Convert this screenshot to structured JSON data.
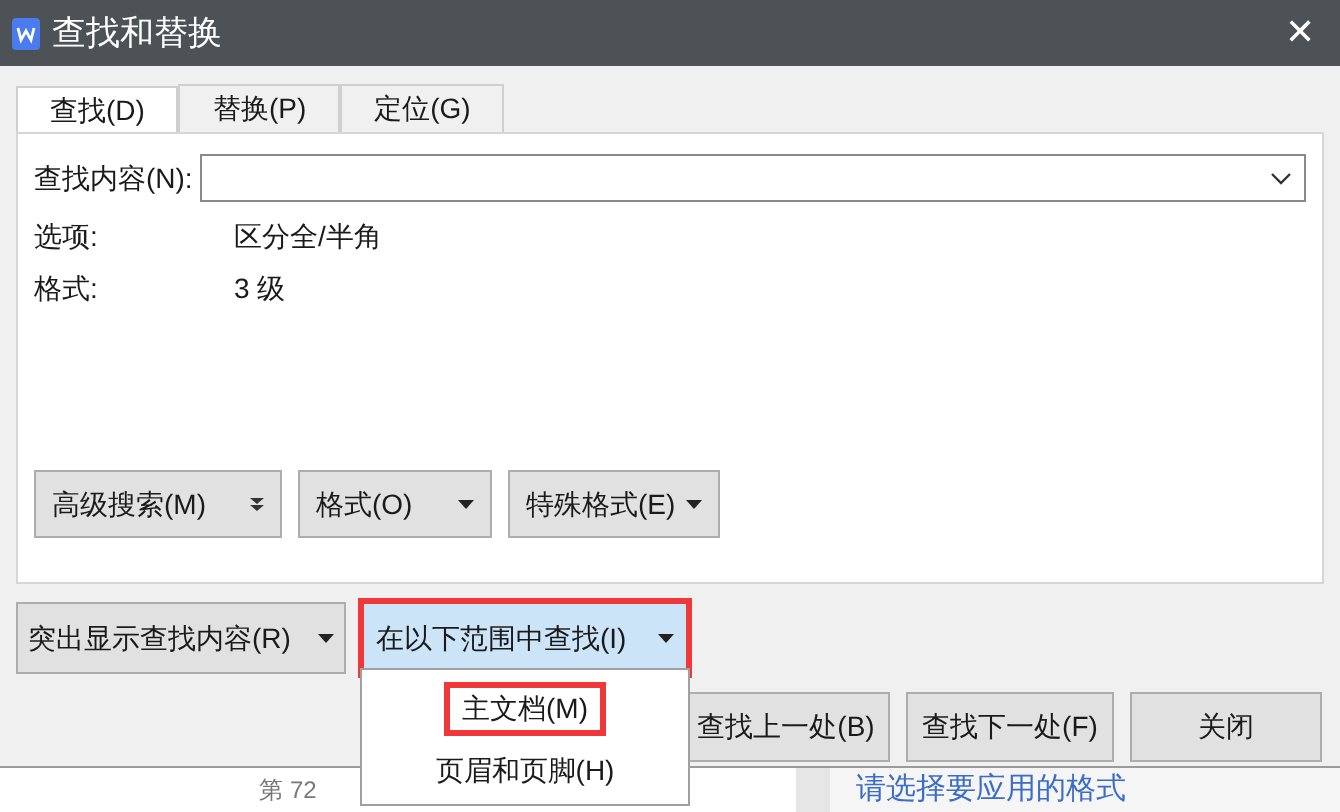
{
  "window": {
    "title": "查找和替换",
    "close": "✕"
  },
  "tabs": [
    {
      "label": "查找(D)",
      "selected": true
    },
    {
      "label": "替换(P)",
      "selected": false
    },
    {
      "label": "定位(G)",
      "selected": false
    }
  ],
  "find": {
    "label": "查找内容(N):"
  },
  "info": [
    {
      "label": "选项:",
      "value": "区分全/半角"
    },
    {
      "label": "格式:",
      "value": "3 级"
    }
  ],
  "panel_buttons": [
    {
      "label": "高级搜索(M)",
      "kind": "expand"
    },
    {
      "label": "格式(O)",
      "kind": "dropdown"
    },
    {
      "label": "特殊格式(E)",
      "kind": "dropdown"
    }
  ],
  "highlight_button": {
    "label": "突出显示查找内容(R)"
  },
  "scope_button": {
    "label": "在以下范围中查找(I)",
    "expanded": true,
    "marked": true
  },
  "scope_menu": [
    {
      "label": "主文档(M)",
      "marked": true
    },
    {
      "label": "页眉和页脚(H)",
      "marked": false
    }
  ],
  "action_buttons": [
    "查找上一处(B)",
    "查找下一处(F)",
    "关闭"
  ],
  "background": {
    "page_text": "第 72",
    "panel_text": "请选择要应用的格式"
  }
}
